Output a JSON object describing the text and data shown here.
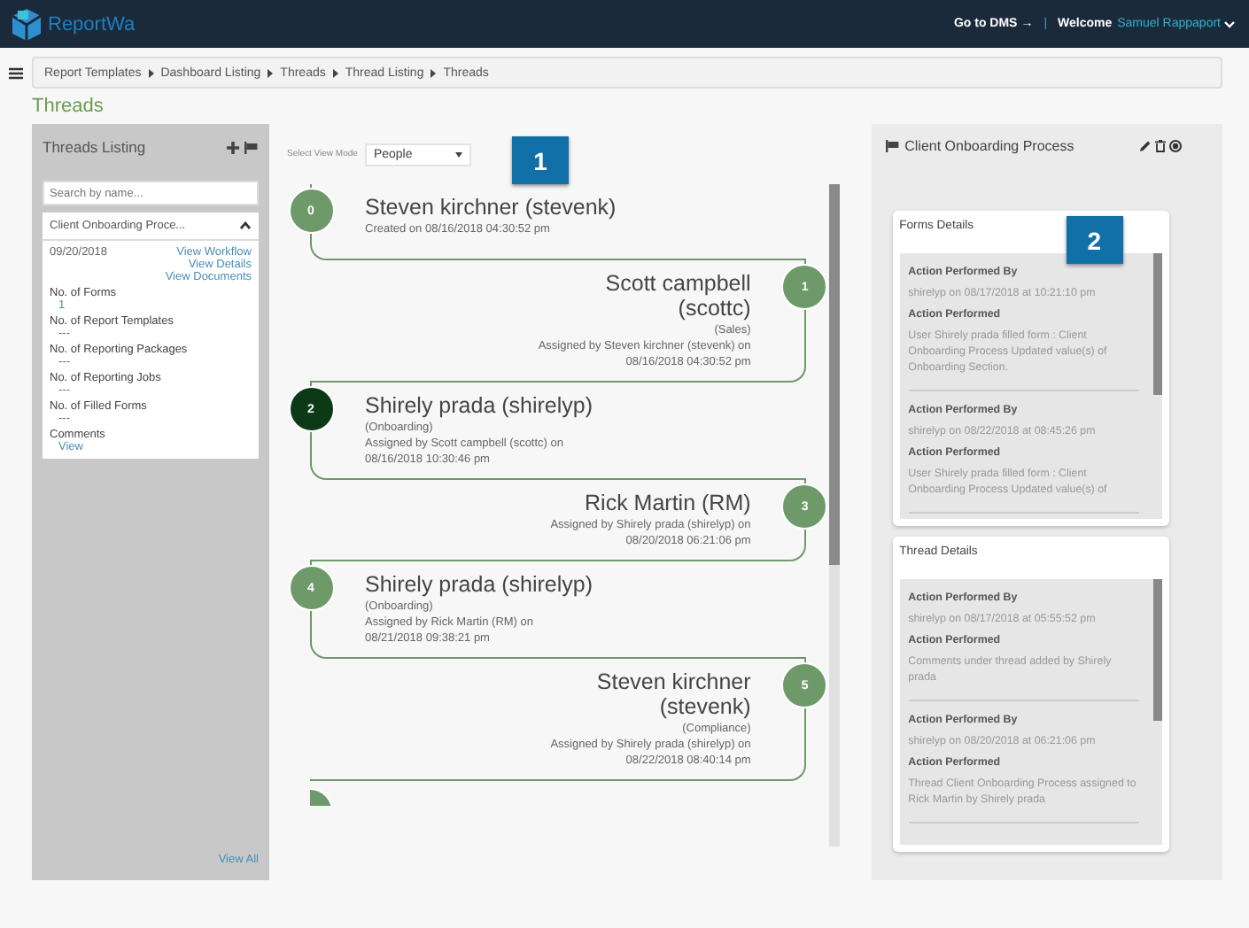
{
  "header": {
    "logo_text": "ReportWa",
    "goto": "Go to DMS",
    "goto_arrow": "→",
    "separator": "|",
    "welcome": "Welcome",
    "user": "Samuel Rappaport"
  },
  "breadcrumb": [
    "Report Templates",
    "Dashboard Listing",
    "Threads",
    "Thread Listing",
    "Threads"
  ],
  "page_title": "Threads",
  "sidebar": {
    "title": "Threads Listing",
    "search": {
      "placeholder": "Search by name..."
    },
    "thread": {
      "title": "Client Onboarding Proce...",
      "expanded": true,
      "date": "09/20/2018",
      "links": [
        "View Workflow",
        "View Details",
        "View Documents"
      ],
      "fields": [
        {
          "label": "No. of Forms",
          "value": "1",
          "kind": "number"
        },
        {
          "label": "No. of Report Templates",
          "value": "---",
          "kind": "plain"
        },
        {
          "label": "No. of Reporting Packages",
          "value": "---",
          "kind": "plain"
        },
        {
          "label": "No. of Reporting Jobs",
          "value": "---",
          "kind": "plain"
        },
        {
          "label": "No. of Filled Forms",
          "value": "---",
          "kind": "plain"
        },
        {
          "label": "Comments",
          "value": "View",
          "kind": "link"
        }
      ]
    },
    "view_all": "View All"
  },
  "timeline": {
    "view_mode_label": "Select View Mode",
    "view_mode": "People",
    "callout": "1",
    "more_below": true,
    "steps": [
      {
        "number": "0",
        "kind": "left",
        "selected": false,
        "name": "Steven kirchner (stevenk)",
        "lines": [
          "Created on 08/16/2018 04:30:52 pm"
        ]
      },
      {
        "number": "1",
        "kind": "right",
        "selected": false,
        "name": "Scott campbell (scottc)",
        "lines": [
          "(Sales)",
          "Assigned by Steven kirchner (stevenk) on 08/16/2018 04:30:52 pm"
        ]
      },
      {
        "number": "2",
        "kind": "left",
        "selected": true,
        "name": "Shirely prada (shirelyp)",
        "lines": [
          "(Onboarding)",
          "Assigned by Scott campbell (scottc) on 08/16/2018 10:30:46 pm"
        ]
      },
      {
        "number": "3",
        "kind": "right",
        "selected": false,
        "name": "Rick Martin (RM)",
        "lines": [
          "Assigned by Shirely prada (shirelyp) on 08/20/2018 06:21:06 pm"
        ]
      },
      {
        "number": "4",
        "kind": "left",
        "selected": false,
        "name": "Shirely prada (shirelyp)",
        "lines": [
          "(Onboarding)",
          "Assigned by Rick Martin (RM) on 08/21/2018 09:38:21 pm"
        ]
      },
      {
        "number": "5",
        "kind": "right",
        "selected": false,
        "name": "Steven kirchner (stevenk)",
        "lines": [
          "(Compliance)",
          "Assigned by Shirely prada (shirelyp) on 08/22/2018 08:40:14 pm"
        ]
      }
    ]
  },
  "details": {
    "title": "Client Onboarding Process",
    "callout": "2",
    "cards": [
      {
        "title": "Forms Details",
        "entries": [
          {
            "by_label": "Action Performed By",
            "by": "shirelyp on 08/17/2018 at 10:21:10 pm",
            "action_label": "Action Performed",
            "action": "User Shirely prada filled form : Client Onboarding Process Updated value(s) of Onboarding Section."
          },
          {
            "by_label": "Action Performed By",
            "by": "shirelyp on 08/22/2018 at 08:45:26 pm",
            "action_label": "Action Performed",
            "action": "User Shirely prada filled form : Client Onboarding Process Updated value(s) of"
          }
        ]
      },
      {
        "title": "Thread Details",
        "entries": [
          {
            "by_label": "Action Performed By",
            "by": "shirelyp on 08/17/2018 at 05:55:52 pm",
            "action_label": "Action Performed",
            "action": "Comments under thread added by Shirely prada"
          },
          {
            "by_label": "Action Performed By",
            "by": "shirelyp on 08/20/2018 at 06:21:06 pm",
            "action_label": "Action Performed",
            "action": "Thread Client Onboarding Process assigned to Rick Martin by Shirely prada"
          }
        ]
      }
    ]
  }
}
